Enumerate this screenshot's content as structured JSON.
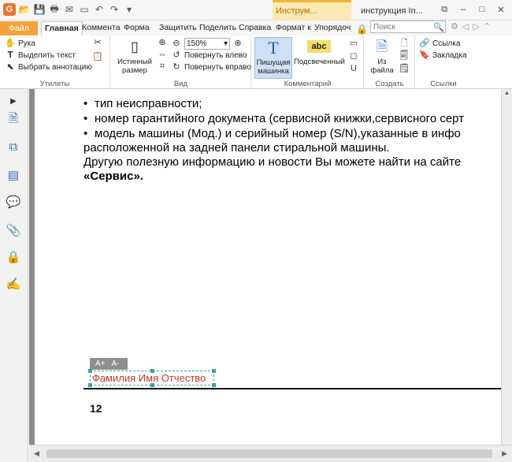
{
  "titlebar": {
    "context_tab": "Инструм...",
    "document_title": "инструкция In..."
  },
  "tabs": [
    {
      "label": "Файл"
    },
    {
      "label": "Главная"
    },
    {
      "label": "Коммента"
    },
    {
      "label": "Форма"
    },
    {
      "label": "Защитить"
    },
    {
      "label": "Поделить"
    },
    {
      "label": "Справка"
    },
    {
      "label": "Формат к"
    },
    {
      "label": "Упорядоч"
    }
  ],
  "search": {
    "placeholder": "Поиск"
  },
  "ribbon": {
    "utilities": {
      "hand": "Рука",
      "select_text": "Выделить текст",
      "select_annotation": "Выбрать аннотацию",
      "group_label": "Утилиты"
    },
    "view": {
      "actual_size": "Истинный размер",
      "zoom": "150%",
      "rotate_left": "Повернуть влево",
      "rotate_right": "Повернуть вправо",
      "group_label": "Вид"
    },
    "comment": {
      "typewriter": "Пишущая машинка",
      "highlight": "Подсвеченный",
      "highlight_icon_text": "abc",
      "group_label": "Комментарий"
    },
    "create": {
      "from_file": "Из файла",
      "group_label": "Создать"
    },
    "links": {
      "link": "Ссылка",
      "bookmark": "Закладка",
      "group_label": "Ссылки"
    }
  },
  "document": {
    "line1": "тип неисправности;",
    "line2": "номер гарантийного документа (сервисной книжки,сервисного серт",
    "line3": "модель машины (Мод.) и  серийный номер (S/N),указанные в инфо",
    "line4": "расположенной на задней панели  стиральной машины.",
    "line5": "Другую полезную информацию и  новости  Вы можете найти  на сайте",
    "line6": "«Сервис».",
    "font_up": "A+",
    "font_down": "A-",
    "signature": "Фамилия Имя Отчество",
    "page_number": "12"
  }
}
